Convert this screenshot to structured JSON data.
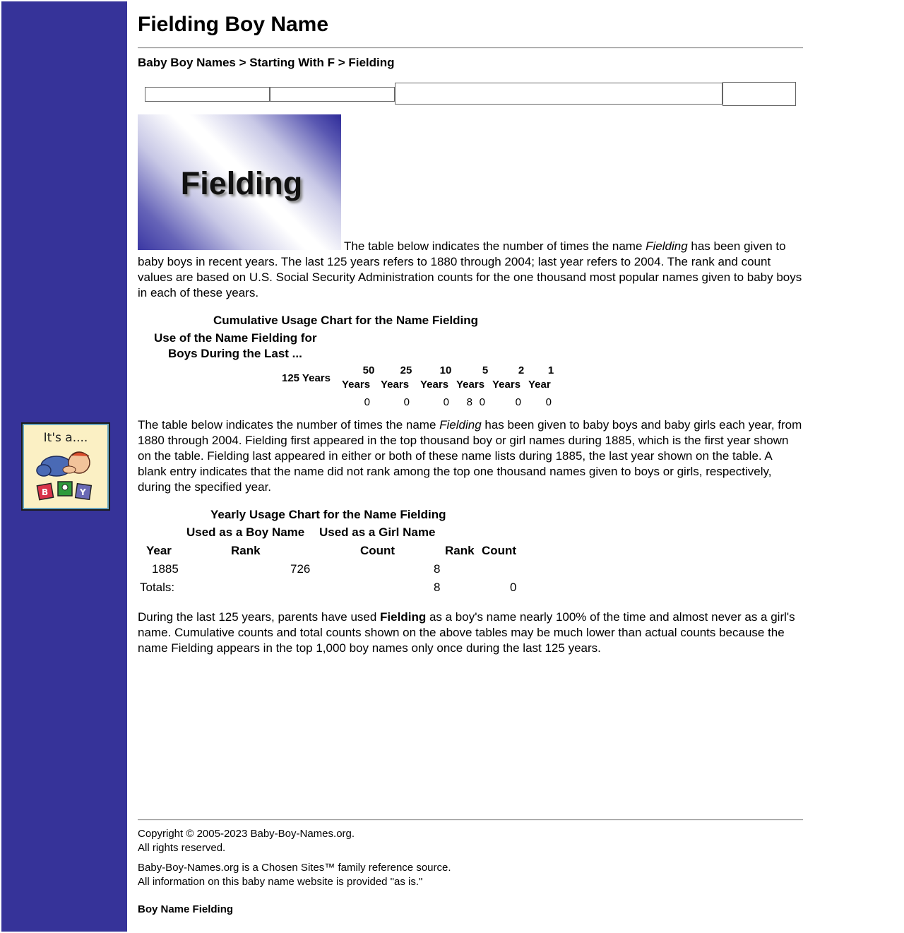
{
  "page": {
    "title": "Fielding Boy Name"
  },
  "breadcrumb": {
    "level1": "Baby Boy Names",
    "sep1": " > ",
    "level2": "Starting With F",
    "sep2": " > ",
    "current": "Fielding"
  },
  "hero": {
    "name": "Fielding"
  },
  "sidebar": {
    "logo_text": "It's a...."
  },
  "intro": {
    "before_name": "The table below indicates the number of times the name ",
    "name": "Fielding",
    "after_name": " has been given to baby boys in recent years.  The last 125 years refers to 1880 through 2004; last year refers to 2004.  The rank and count values are based on U.S. Social Security Administration counts for the one thousand most popular names given to baby boys in each of these years."
  },
  "cumulative": {
    "caption": "Cumulative Usage Chart for the Name Fielding",
    "subcaption_line1": "Use of the Name Fielding for",
    "subcaption_line2": "Boys During the Last ...",
    "headers": [
      {
        "top": "",
        "bottom": "125 Years"
      },
      {
        "top": "50",
        "bottom": "Years"
      },
      {
        "top": "25",
        "bottom": "Years"
      },
      {
        "top": "10",
        "bottom": "Years"
      },
      {
        "top": "5",
        "bottom": "Years"
      },
      {
        "top": "2",
        "bottom": "Years"
      },
      {
        "top": "1",
        "bottom": "Year"
      }
    ],
    "values": [
      "8",
      "0",
      "0",
      "0",
      "0",
      "0",
      "0"
    ]
  },
  "yearly_intro": {
    "before_name": "The table below indicates the number of times the name ",
    "name": "Fielding",
    "after_name": " has been given to baby boys and baby girls each year, from 1880 through 2004.  Fielding first appeared in the top thousand boy or girl names during 1885, which is the first year shown on the table.  Fielding last appeared in either or both of these name lists during 1885, the last year shown on the table.  A blank entry indicates that the name did not rank among the top one thousand names given to boys or girls, respectively, during the specified year."
  },
  "yearly": {
    "caption": "Yearly Usage Chart for the Name Fielding",
    "group_boy": "Used as a Boy Name",
    "group_girl": "Used as a Girl Name",
    "col_year": "Year",
    "col_boy_rank": "Rank",
    "col_boy_count": "Count",
    "col_girl_rank": "Rank",
    "col_girl_count": "Count",
    "rows": [
      {
        "year": "1885",
        "boy_rank": "726",
        "boy_count": "8",
        "girl_rank": "",
        "girl_count": ""
      }
    ],
    "totals_label": "Totals:",
    "totals_boy": "8",
    "totals_girl": "0"
  },
  "summary": {
    "before_name": "During the last 125 years, parents have used ",
    "name": "Fielding",
    "after_name": " as a boy's name nearly 100% of the time and almost never as a girl's name.  Cumulative counts and total counts shown on the above tables may be much lower than actual counts because the name Fielding appears in the top 1,000 boy names only once during the last 125 years."
  },
  "footer": {
    "copyright": "Copyright © 2005-2023 Baby-Boy-Names.org.",
    "rights": "All rights reserved.",
    "family": "Baby-Boy-Names.org is a Chosen Sites™ family reference source.",
    "asis": "All information on this baby name website is provided \"as is.\"",
    "bottom_title": "Boy Name Fielding"
  }
}
